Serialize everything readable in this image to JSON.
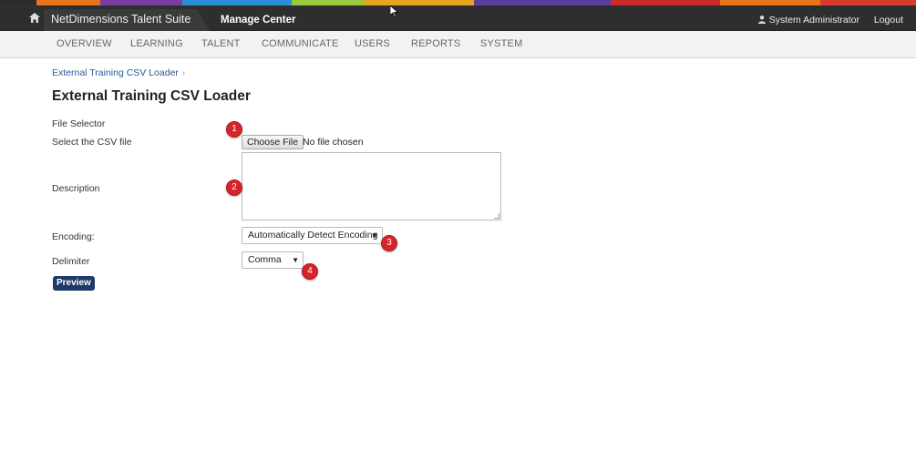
{
  "header": {
    "brand": "NetDimensions Talent Suite",
    "section": "Manage Center",
    "user": "System Administrator",
    "logout": "Logout"
  },
  "nav": {
    "items": [
      "OVERVIEW",
      "LEARNING",
      "TALENT",
      "COMMUNICATE",
      "USERS",
      "REPORTS",
      "SYSTEM"
    ]
  },
  "breadcrumb": {
    "item": "External Training CSV Loader",
    "separator": "›"
  },
  "page": {
    "title": "External Training CSV Loader"
  },
  "form": {
    "file_selector_label": "File Selector",
    "csv_label": "Select the CSV file",
    "choose_file_button": "Choose File",
    "file_status": "No file chosen",
    "description_label": "Description",
    "description_value": "",
    "encoding_label": "Encoding:",
    "encoding_value": "Automatically Detect Encoding",
    "delimiter_label": "Delimiter",
    "delimiter_value": "Comma",
    "preview_button": "Preview"
  },
  "markers": [
    "1",
    "2",
    "3",
    "4"
  ],
  "colors": {
    "topbar": "#2e2e2e",
    "marker": "#d8232a",
    "preview_button": "#1e3a66",
    "link": "#2a5a9a"
  }
}
